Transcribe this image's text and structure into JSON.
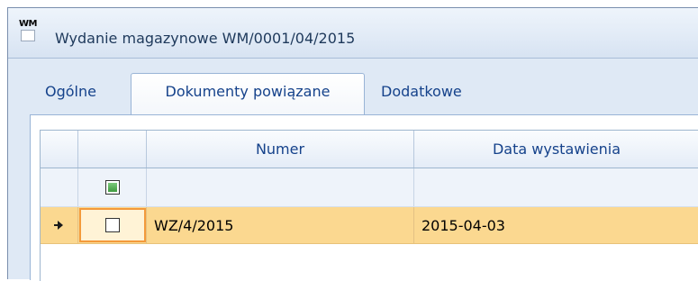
{
  "window": {
    "icon_text": "WM",
    "title": "Wydanie magazynowe WM/0001/04/2015"
  },
  "tabs": [
    {
      "label": "Ogólne",
      "active": false
    },
    {
      "label": "Dokumenty powiązane",
      "active": true
    },
    {
      "label": "Dodatkowe",
      "active": false
    }
  ],
  "grid": {
    "columns": [
      "",
      "",
      "Numer",
      "Data wystawienia"
    ],
    "filter_row": {
      "checkbox_state": "indeterminate"
    },
    "rows": [
      {
        "indicator": "current-row",
        "checked": false,
        "numer": "WZ/4/2015",
        "data_wystawienia": "2015-04-03",
        "selected": true
      }
    ]
  },
  "colors": {
    "selected_row": "#fbd890",
    "focus_border": "#f39a3b",
    "header_text": "#15428b"
  }
}
